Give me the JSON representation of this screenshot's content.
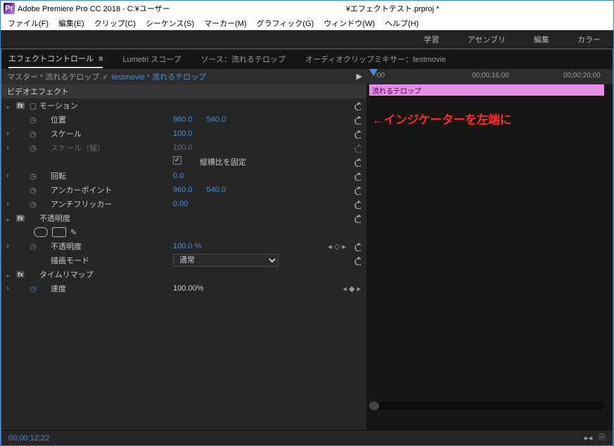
{
  "titlebar": {
    "app_abbrev": "Pr",
    "text": "Adobe Premiere Pro CC 2018 - C:¥ユーザー",
    "text2_suffix": "¥エフェクトテスト.prproj *"
  },
  "menubar": {
    "file": "ファイル(F)",
    "edit": "編集(E)",
    "clip": "クリップ(C)",
    "sequence": "シーケンス(S)",
    "marker": "マーカー(M)",
    "graphic": "グラフィック(G)",
    "window": "ウィンドウ(W)",
    "help": "ヘルプ(H)"
  },
  "workspaces": {
    "learn": "学習",
    "assembly": "アセンブリ",
    "edit": "編集",
    "color": "カラー"
  },
  "panel_tabs": {
    "effect_controls": "エフェクトコントロール",
    "burger": "≡",
    "lumetri": "Lumetri スコープ",
    "source": "ソース：流れるテロップ",
    "audio_mixer": "オーディオクリップミキサー：testmovie"
  },
  "master_row": {
    "master": "マスター * 流れるテロップ",
    "sep": "✓",
    "clip": "testmovie * 流れるテロップ",
    "play": "▶"
  },
  "headers": {
    "video_effects": "ビデオエフェクト"
  },
  "motion": {
    "group": "モーション",
    "position": "位置",
    "pos_x": "960.0",
    "pos_y": "540.0",
    "scale": "スケール",
    "scale_v": "100.0",
    "scale_w": "スケール（幅）",
    "scale_w_v": "100.0",
    "lock_aspect": "縦横比を固定",
    "rotation": "回転",
    "rotation_v": "0.0",
    "anchor": "アンカーポイント",
    "anchor_x": "960.0",
    "anchor_y": "540.0",
    "antiflicker": "アンチフリッカー",
    "antiflicker_v": "0.00"
  },
  "opacity": {
    "group": "不透明度",
    "opacity": "不透明度",
    "opacity_v": "100.0 %",
    "blend_mode": "描画モード",
    "blend_v": "通常"
  },
  "time_remap": {
    "group": "タイムリマップ",
    "speed": "速度",
    "speed_v": "100.00%"
  },
  "timeline": {
    "tc1": ":00",
    "tc2": "00;00;16;00",
    "tc3": "00;00;20;00",
    "clip_name": "流れるテロップ",
    "annotation": "←インジケーターを左端に"
  },
  "footer": {
    "timecode": "00;00;12;22"
  }
}
